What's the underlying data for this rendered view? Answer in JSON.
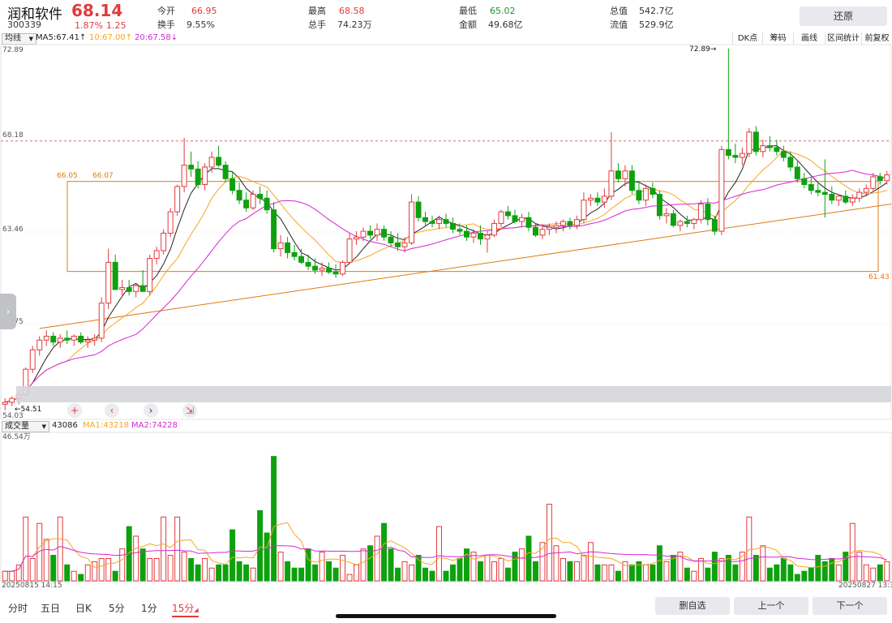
{
  "header": {
    "name": "润和软件",
    "price": "68.14",
    "code": "300339",
    "change_pct": "1.87%",
    "change_val": "1.25",
    "quotes": [
      {
        "label": "今开",
        "value": "66.95",
        "color": "red"
      },
      {
        "label": "换手",
        "value": "9.55%",
        "color": "dark"
      },
      {
        "label": "最高",
        "value": "68.58",
        "color": "red"
      },
      {
        "label": "总手",
        "value": "74.23万",
        "color": "dark"
      },
      {
        "label": "最低",
        "value": "65.02",
        "color": "green"
      },
      {
        "label": "金额",
        "value": "49.68亿",
        "color": "dark"
      },
      {
        "label": "总值",
        "value": "542.7亿",
        "color": "dark"
      },
      {
        "label": "流值",
        "value": "529.9亿",
        "color": "dark"
      }
    ],
    "restore_label": "还原"
  },
  "ma_bar": {
    "type": "均线",
    "ma5": "MA5:67.41↑",
    "ma10": "10:67.00↑",
    "ma20": "20:67.58↓",
    "tools": [
      "DK点",
      "筹码",
      "画线",
      "区间统计",
      "前复权"
    ]
  },
  "price_axis": [
    "72.89",
    "68.18",
    "63.46",
    "58.75",
    "54.03"
  ],
  "annotations": {
    "high": "72.89→",
    "low": "←54.51",
    "box_left": "66.05",
    "box_left2": "66.07",
    "box_right": "61.43"
  },
  "volume_bar": {
    "type": "成交量",
    "current": "43086",
    "ma1": "MA1:43218",
    "ma2": "MA2:74228",
    "axis_top": "46.54万"
  },
  "time_axis": {
    "start": "20250815 14:15",
    "end": "20250827 13:30"
  },
  "periods": [
    {
      "label": "分时",
      "active": false
    },
    {
      "label": "五日",
      "active": false
    },
    {
      "label": "日K",
      "active": false
    },
    {
      "label": "5分",
      "active": false
    },
    {
      "label": "1分",
      "active": false
    },
    {
      "label": "15分",
      "active": true
    }
  ],
  "actions": {
    "delete": "删自选",
    "prev": "上一个",
    "next": "下一个"
  },
  "colors": {
    "up": "#e4393c",
    "down": "#0ea10e",
    "ma5": "#222222",
    "ma10": "#f5a623",
    "ma20": "#d627d6",
    "box": "#e07a10"
  },
  "chart_data": {
    "type": "candlestick",
    "ylim": [
      54.03,
      72.89
    ],
    "candles": [
      [
        54.6,
        54.9,
        54.3,
        54.7
      ],
      [
        54.7,
        55.0,
        54.5,
        54.9
      ],
      [
        54.9,
        55.2,
        54.6,
        55.1
      ],
      [
        55.1,
        56.5,
        55.0,
        56.4
      ],
      [
        56.4,
        57.6,
        56.2,
        57.4
      ],
      [
        57.4,
        58.1,
        57.1,
        57.9
      ],
      [
        57.9,
        58.4,
        57.6,
        58.1
      ],
      [
        58.1,
        58.3,
        57.6,
        57.8
      ],
      [
        57.8,
        58.2,
        57.5,
        58.0
      ],
      [
        58.0,
        58.4,
        57.7,
        57.9
      ],
      [
        57.9,
        58.2,
        57.6,
        58.1
      ],
      [
        58.1,
        58.3,
        57.7,
        57.8
      ],
      [
        57.8,
        58.1,
        57.5,
        57.9
      ],
      [
        57.9,
        58.2,
        57.6,
        58.0
      ],
      [
        58.0,
        60.1,
        57.8,
        59.8
      ],
      [
        59.8,
        62.6,
        59.5,
        61.9
      ],
      [
        61.9,
        62.3,
        60.8,
        60.5
      ],
      [
        60.5,
        61.0,
        60.1,
        60.6
      ],
      [
        60.6,
        61.0,
        60.2,
        60.4
      ],
      [
        60.4,
        60.8,
        60.1,
        60.7
      ],
      [
        60.7,
        61.5,
        60.5,
        60.4
      ],
      [
        60.4,
        62.3,
        60.2,
        62.1
      ],
      [
        62.1,
        62.7,
        61.8,
        62.5
      ],
      [
        62.5,
        63.6,
        62.3,
        63.4
      ],
      [
        63.4,
        64.7,
        63.2,
        64.5
      ],
      [
        64.5,
        65.9,
        64.3,
        65.8
      ],
      [
        65.8,
        68.3,
        65.5,
        66.9
      ],
      [
        66.9,
        67.6,
        66.3,
        66.7
      ],
      [
        66.7,
        67.1,
        65.7,
        65.9
      ],
      [
        65.9,
        67.0,
        65.6,
        66.8
      ],
      [
        66.8,
        67.6,
        66.5,
        67.3
      ],
      [
        67.3,
        67.9,
        66.8,
        66.9
      ],
      [
        66.9,
        67.1,
        66.0,
        66.2
      ],
      [
        66.2,
        66.6,
        65.4,
        65.6
      ],
      [
        65.6,
        66.0,
        64.9,
        65.1
      ],
      [
        65.1,
        65.5,
        64.5,
        64.7
      ],
      [
        64.7,
        65.6,
        64.6,
        65.4
      ],
      [
        65.4,
        65.8,
        64.9,
        65.2
      ],
      [
        65.2,
        65.6,
        64.4,
        64.6
      ],
      [
        64.6,
        65.0,
        62.4,
        62.6
      ],
      [
        62.6,
        63.3,
        62.2,
        62.9
      ],
      [
        62.9,
        63.2,
        62.1,
        62.4
      ],
      [
        62.4,
        62.8,
        62.0,
        62.2
      ],
      [
        62.2,
        62.6,
        61.8,
        61.9
      ],
      [
        61.9,
        62.3,
        61.5,
        61.7
      ],
      [
        61.7,
        62.1,
        61.3,
        61.5
      ],
      [
        61.5,
        61.9,
        61.2,
        61.6
      ],
      [
        61.6,
        61.9,
        61.3,
        61.4
      ],
      [
        61.4,
        61.8,
        61.1,
        61.3
      ],
      [
        61.3,
        62.0,
        61.2,
        61.9
      ],
      [
        61.9,
        63.4,
        61.8,
        63.1
      ],
      [
        63.1,
        63.5,
        62.8,
        63.2
      ],
      [
        63.2,
        63.7,
        63.0,
        63.5
      ],
      [
        63.5,
        63.8,
        63.1,
        63.3
      ],
      [
        63.3,
        63.9,
        63.0,
        63.6
      ],
      [
        63.6,
        63.8,
        63.0,
        63.2
      ],
      [
        63.2,
        63.5,
        62.7,
        62.9
      ],
      [
        62.9,
        63.4,
        62.5,
        62.7
      ],
      [
        62.7,
        63.2,
        62.4,
        62.9
      ],
      [
        62.9,
        65.4,
        62.8,
        65.0
      ],
      [
        65.0,
        65.3,
        64.0,
        64.2
      ],
      [
        64.2,
        64.5,
        63.8,
        64.0
      ],
      [
        64.0,
        64.3,
        63.7,
        63.9
      ],
      [
        63.9,
        64.3,
        63.6,
        64.1
      ],
      [
        64.1,
        64.4,
        63.7,
        63.9
      ],
      [
        63.9,
        64.2,
        63.4,
        63.6
      ],
      [
        63.6,
        63.9,
        63.3,
        63.5
      ],
      [
        63.5,
        63.8,
        63.0,
        63.2
      ],
      [
        63.2,
        63.6,
        62.9,
        63.4
      ],
      [
        63.4,
        63.8,
        62.8,
        63.1
      ],
      [
        63.1,
        63.5,
        62.4,
        63.3
      ],
      [
        63.3,
        64.1,
        63.2,
        63.9
      ],
      [
        63.9,
        64.6,
        63.7,
        64.5
      ],
      [
        64.5,
        64.8,
        64.1,
        64.3
      ],
      [
        64.3,
        64.6,
        63.9,
        64.0
      ],
      [
        64.0,
        64.4,
        63.7,
        64.2
      ],
      [
        64.2,
        64.5,
        63.5,
        63.7
      ],
      [
        63.7,
        63.9,
        63.2,
        63.3
      ],
      [
        63.3,
        63.8,
        63.1,
        63.6
      ],
      [
        63.6,
        63.9,
        63.3,
        63.7
      ],
      [
        63.7,
        64.0,
        63.4,
        63.8
      ],
      [
        63.8,
        64.1,
        63.5,
        64.0
      ],
      [
        64.0,
        64.2,
        63.6,
        63.8
      ],
      [
        63.8,
        64.3,
        63.6,
        64.1
      ],
      [
        64.1,
        65.5,
        63.9,
        65.1
      ],
      [
        65.1,
        65.4,
        64.8,
        65.2
      ],
      [
        65.2,
        65.5,
        64.8,
        65.0
      ],
      [
        65.0,
        65.7,
        64.7,
        65.3
      ],
      [
        65.3,
        68.6,
        65.1,
        66.6
      ],
      [
        66.6,
        67.0,
        66.0,
        66.2
      ],
      [
        66.2,
        66.9,
        65.8,
        66.6
      ],
      [
        66.6,
        66.9,
        65.4,
        65.6
      ],
      [
        65.6,
        66.1,
        64.9,
        65.1
      ],
      [
        65.1,
        65.9,
        64.8,
        65.7
      ],
      [
        65.7,
        66.0,
        65.2,
        65.4
      ],
      [
        65.4,
        65.6,
        64.1,
        64.3
      ],
      [
        64.3,
        64.7,
        63.9,
        64.4
      ],
      [
        64.4,
        64.6,
        63.7,
        63.8
      ],
      [
        63.8,
        64.1,
        63.5,
        64.0
      ],
      [
        64.0,
        64.3,
        63.7,
        63.9
      ],
      [
        63.9,
        64.2,
        63.6,
        64.1
      ],
      [
        64.1,
        65.1,
        63.9,
        64.9
      ],
      [
        64.9,
        65.2,
        63.8,
        64.1
      ],
      [
        64.1,
        64.3,
        63.3,
        63.5
      ],
      [
        63.5,
        67.9,
        63.3,
        67.7
      ],
      [
        67.7,
        72.9,
        67.2,
        67.4
      ],
      [
        67.4,
        68.0,
        67.0,
        67.3
      ],
      [
        67.3,
        67.8,
        66.9,
        67.5
      ],
      [
        67.5,
        68.8,
        67.3,
        68.6
      ],
      [
        68.6,
        68.9,
        67.4,
        67.6
      ],
      [
        67.6,
        68.2,
        67.3,
        67.9
      ],
      [
        67.9,
        68.4,
        67.6,
        67.8
      ],
      [
        67.8,
        68.2,
        67.4,
        67.6
      ],
      [
        67.6,
        67.9,
        67.1,
        67.3
      ],
      [
        67.3,
        67.6,
        66.6,
        66.8
      ],
      [
        66.8,
        67.1,
        66.0,
        66.2
      ],
      [
        66.2,
        66.5,
        65.7,
        65.9
      ],
      [
        65.9,
        66.3,
        65.4,
        65.6
      ],
      [
        65.6,
        66.0,
        65.3,
        65.5
      ],
      [
        65.5,
        67.2,
        64.2,
        65.4
      ],
      [
        65.4,
        65.8,
        64.9,
        65.1
      ],
      [
        65.1,
        65.4,
        64.8,
        65.3
      ],
      [
        65.3,
        65.6,
        64.9,
        65.0
      ],
      [
        65.0,
        65.4,
        64.8,
        65.2
      ],
      [
        65.2,
        65.7,
        65.0,
        65.5
      ],
      [
        65.5,
        65.9,
        65.3,
        65.7
      ],
      [
        65.7,
        66.5,
        65.6,
        66.3
      ],
      [
        66.3,
        66.5,
        65.9,
        66.1
      ],
      [
        66.1,
        66.6,
        65.9,
        66.4
      ]
    ],
    "volumes": [
      0.03,
      0.03,
      0.05,
      0.2,
      0.07,
      0.18,
      0.13,
      0.08,
      0.2,
      0.05,
      0.03,
      0.02,
      0.05,
      0.06,
      0.07,
      0.07,
      0.03,
      0.1,
      0.17,
      0.14,
      0.1,
      0.07,
      0.07,
      0.2,
      0.08,
      0.2,
      0.09,
      0.07,
      0.05,
      0.07,
      0.04,
      0.05,
      0.05,
      0.16,
      0.06,
      0.05,
      0.04,
      0.22,
      0.15,
      0.39,
      0.09,
      0.06,
      0.04,
      0.04,
      0.1,
      0.05,
      0.09,
      0.06,
      0.04,
      0.08,
      0.02,
      0.05,
      0.1,
      0.11,
      0.14,
      0.18,
      0.1,
      0.04,
      0.06,
      0.05,
      0.08,
      0.04,
      0.03,
      0.17,
      0.03,
      0.05,
      0.07,
      0.1,
      0.09,
      0.06,
      0.08,
      0.06,
      0.07,
      0.04,
      0.09,
      0.1,
      0.14,
      0.06,
      0.12,
      0.24,
      0.11,
      0.07,
      0.06,
      0.06,
      0.08,
      0.12,
      0.05,
      0.05,
      0.05,
      0.03,
      0.06,
      0.05,
      0.06,
      0.05,
      0.05,
      0.11,
      0.06,
      0.08,
      0.09,
      0.04,
      0.03,
      0.07,
      0.04,
      0.09,
      0.07,
      0.08,
      0.05,
      0.09,
      0.2,
      0.08,
      0.11,
      0.04,
      0.05,
      0.07,
      0.05,
      0.02,
      0.03,
      0.04,
      0.08,
      0.06,
      0.07,
      0.05,
      0.09,
      0.18,
      0.09,
      0.05,
      0.04,
      0.05,
      0.06
    ],
    "trendline": [
      [
        5,
        58.5
      ],
      [
        133,
        64.9
      ]
    ],
    "box": {
      "top": 66.06,
      "bottom": 61.43
    }
  }
}
